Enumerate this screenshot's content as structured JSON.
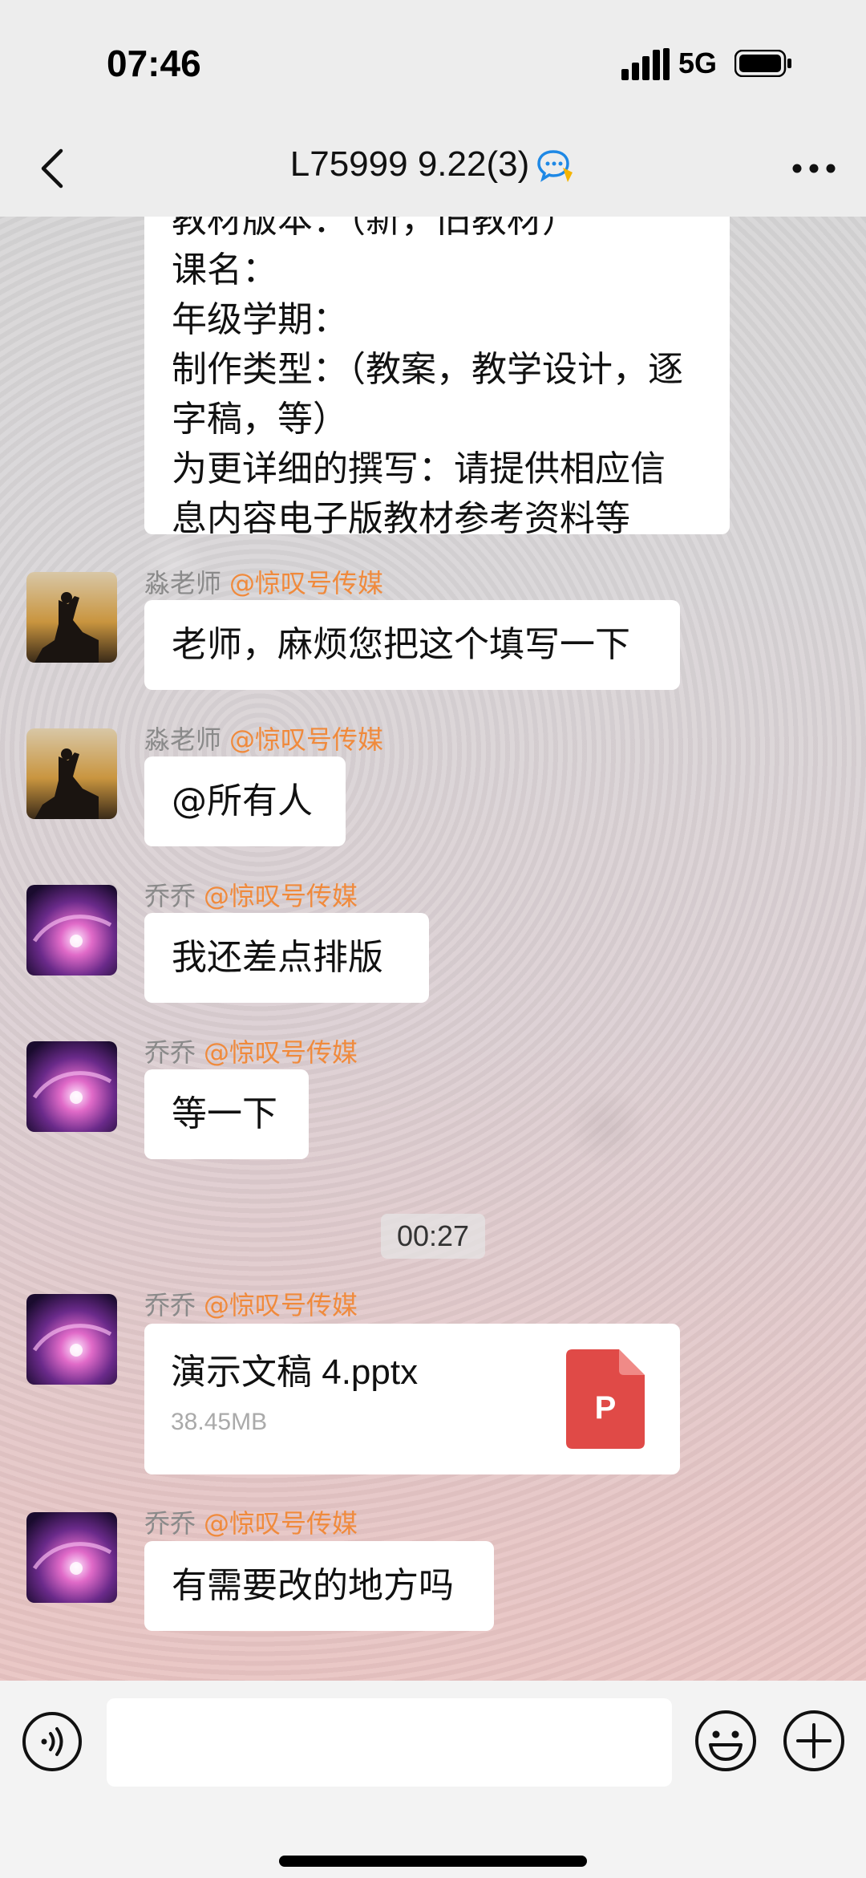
{
  "status": {
    "time": "07:46",
    "network": "5G"
  },
  "nav": {
    "title": "L75999 9.22(3)"
  },
  "messages": {
    "template_lines": [
      "教材版本：（新，旧教材）",
      "课名：",
      "年级学期：",
      "制作类型：（教案，教学设计，逐",
      "字稿，等）",
      "为更详细的撰写：请提供相应信",
      "息内容电子版教材参考资料等"
    ],
    "m1": {
      "sender": "淼老师",
      "tag": "@惊叹号传媒",
      "text": "老师，麻烦您把这个填写一下"
    },
    "m2": {
      "sender": "淼老师",
      "tag": "@惊叹号传媒",
      "text": "@所有人"
    },
    "m3": {
      "sender": "乔乔",
      "tag": "@惊叹号传媒",
      "text": "我还差点排版"
    },
    "m4": {
      "sender": "乔乔",
      "tag": "@惊叹号传媒",
      "text": "等一下"
    },
    "timestamp": "00:27",
    "m5": {
      "sender": "乔乔",
      "tag": "@惊叹号传媒",
      "file_name": "演示文稿 4.pptx",
      "file_size": "38.45MB",
      "file_icon_letter": "P"
    },
    "m6": {
      "sender": "乔乔",
      "tag": "@惊叹号传媒",
      "text": "有需要改的地方吗"
    }
  },
  "input": {
    "value": ""
  },
  "icons": {
    "back": "chevron-left-icon",
    "more": "more-dots-icon",
    "title_badge": "chat-bubble-icon",
    "voice": "voice-icon",
    "emoji": "emoji-icon",
    "plus": "plus-icon"
  },
  "colors": {
    "accent_tag": "#f08a3c",
    "ppt_red": "#e04a47",
    "bubble_bg": "#ffffff"
  }
}
